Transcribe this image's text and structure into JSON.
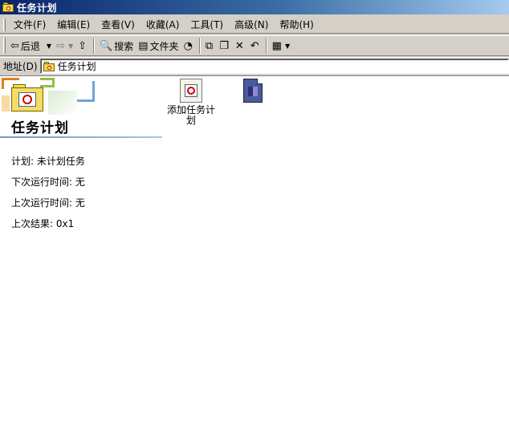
{
  "window": {
    "title": "任务计划"
  },
  "menu": {
    "items": [
      "文件(F)",
      "编辑(E)",
      "查看(V)",
      "收藏(A)",
      "工具(T)",
      "高级(N)",
      "帮助(H)"
    ]
  },
  "toolbar": {
    "back_label": "后退",
    "search_label": "搜索",
    "folders_label": "文件夹"
  },
  "address": {
    "label": "地址(D)",
    "value": "任务计划"
  },
  "panel": {
    "title": "任务计划",
    "schedule": "计划: 未计划任务",
    "next_run": "下次运行时间: 无",
    "last_run": "上次运行时间: 无",
    "last_result": "上次结果: 0x1"
  },
  "files": [
    {
      "label": "添加任务计划",
      "icon": "add-scheduled-task-icon"
    },
    {
      "label": "",
      "icon": "scheduled-task-icon"
    }
  ]
}
